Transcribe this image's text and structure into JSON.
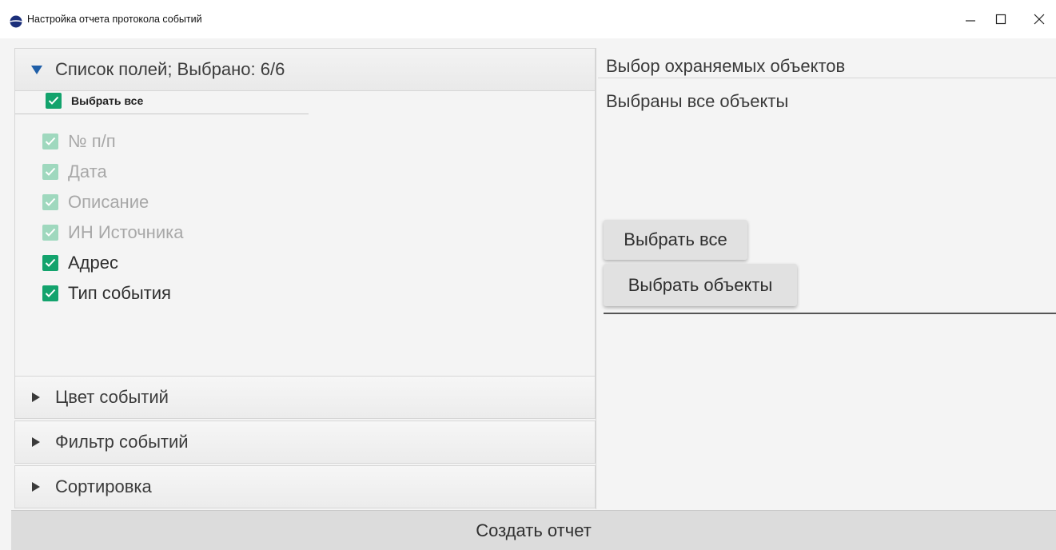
{
  "window": {
    "title": "Настройка отчета протокола событий"
  },
  "field_list": {
    "header": "Список полей; Выбрано: 6/6",
    "select_all_label": "Выбрать все",
    "fields": [
      {
        "label": "№ п/п",
        "checked": true,
        "enabled": false
      },
      {
        "label": "Дата",
        "checked": true,
        "enabled": false
      },
      {
        "label": "Описание",
        "checked": true,
        "enabled": false
      },
      {
        "label": "ИН Источника",
        "checked": true,
        "enabled": false
      },
      {
        "label": "Адрес",
        "checked": true,
        "enabled": true
      },
      {
        "label": "Тип события",
        "checked": true,
        "enabled": true
      }
    ]
  },
  "sections": [
    {
      "label": "Цвет событий"
    },
    {
      "label": "Фильтр событий"
    },
    {
      "label": "Сортировка"
    }
  ],
  "objects_panel": {
    "title": "Выбор охраняемых объектов",
    "status": "Выбраны все объекты",
    "select_all_button": "Выбрать все",
    "select_objects_button": "Выбрать объекты"
  },
  "footer": {
    "create_report_button": "Создать отчет"
  },
  "colors": {
    "checkbox_on": "#13a36d",
    "checkbox_disabled": "#9fd8be",
    "expand_arrow": "#1f5fa8"
  }
}
